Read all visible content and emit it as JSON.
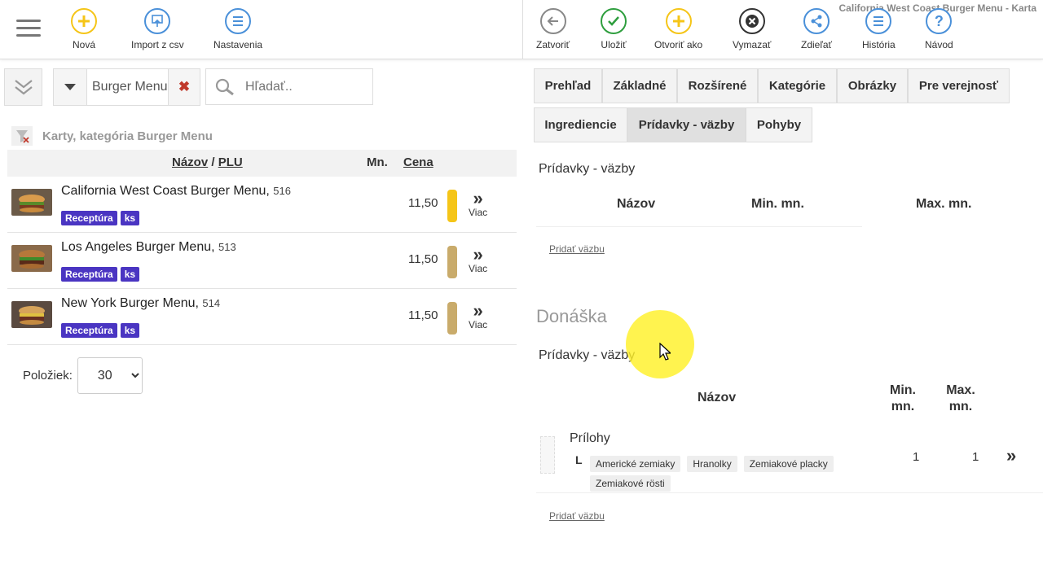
{
  "window_title": "California West Coast Burger Menu - Karta",
  "toolbar_left": [
    {
      "label": "Nová",
      "icon": "plus-icon",
      "color": "#f5c518"
    },
    {
      "label": "Import z csv",
      "icon": "import-icon",
      "color": "#4a90d9"
    },
    {
      "label": "Nastavenia",
      "icon": "menu-list-icon",
      "color": "#4a90d9"
    }
  ],
  "toolbar_right": [
    {
      "label": "Zatvoriť",
      "icon": "arrow-left-icon",
      "color": "#888888"
    },
    {
      "label": "Uložiť",
      "icon": "check-icon",
      "color": "#2e9e3e"
    },
    {
      "label": "Otvoriť ako",
      "icon": "plus-icon",
      "color": "#f5c518"
    },
    {
      "label": "Vymazať",
      "icon": "close-icon",
      "color": "#333333"
    },
    {
      "label": "Zdieľať",
      "icon": "share-icon",
      "color": "#4a90d9"
    },
    {
      "label": "História",
      "icon": "menu-list-icon",
      "color": "#4a90d9"
    },
    {
      "label": "Návod",
      "icon": "help-icon",
      "color": "#4a90d9"
    }
  ],
  "filter": {
    "category": "Burger Menu",
    "search_placeholder": "Hľadať.."
  },
  "list": {
    "caption": "Karty, kategória Burger Menu",
    "header": {
      "name": "Názov",
      "sep": "/",
      "plu": "PLU",
      "qty": "Mn.",
      "price": "Cena"
    },
    "items": [
      {
        "name": "California West Coast Burger Menu",
        "plu": "516",
        "price": "11,50",
        "badges": [
          "Receptúra",
          "ks"
        ],
        "bar_color": "#f5c518",
        "more": "Viac"
      },
      {
        "name": "Los Angeles Burger Menu",
        "plu": "513",
        "price": "11,50",
        "badges": [
          "Receptúra",
          "ks"
        ],
        "bar_color": "#c9ab6b",
        "more": "Viac"
      },
      {
        "name": "New York Burger Menu",
        "plu": "514",
        "price": "11,50",
        "badges": [
          "Receptúra",
          "ks"
        ],
        "bar_color": "#c9ab6b",
        "more": "Viac"
      }
    ],
    "per_page_label": "Položiek:",
    "per_page_value": "30"
  },
  "tabs": [
    "Prehľad",
    "Základné",
    "Rozšírené",
    "Kategórie",
    "Obrázky",
    "Pre verejnosť",
    "Ingrediencie",
    "Prídavky - väzby",
    "Pohyby"
  ],
  "active_tab": "Prídavky - väzby",
  "section1": {
    "title": "Prídavky - väzby",
    "col_name": "Názov",
    "col_min": "Min. mn.",
    "col_max": "Max. mn.",
    "add_link": "Pridať väzbu"
  },
  "delivery": {
    "title": "Donáška",
    "section_title": "Prídavky - väzby",
    "col_name": "Názov",
    "col_min": "Min. mn.",
    "col_max": "Max. mn.",
    "rows": [
      {
        "name": "Prílohy",
        "tree": "L",
        "items": [
          "Americké zemiaky",
          "Hranolky",
          "Zemiakové placky",
          "Zemiakové rösti"
        ],
        "min": "1",
        "max": "1"
      }
    ],
    "add_link": "Pridať väzbu"
  }
}
